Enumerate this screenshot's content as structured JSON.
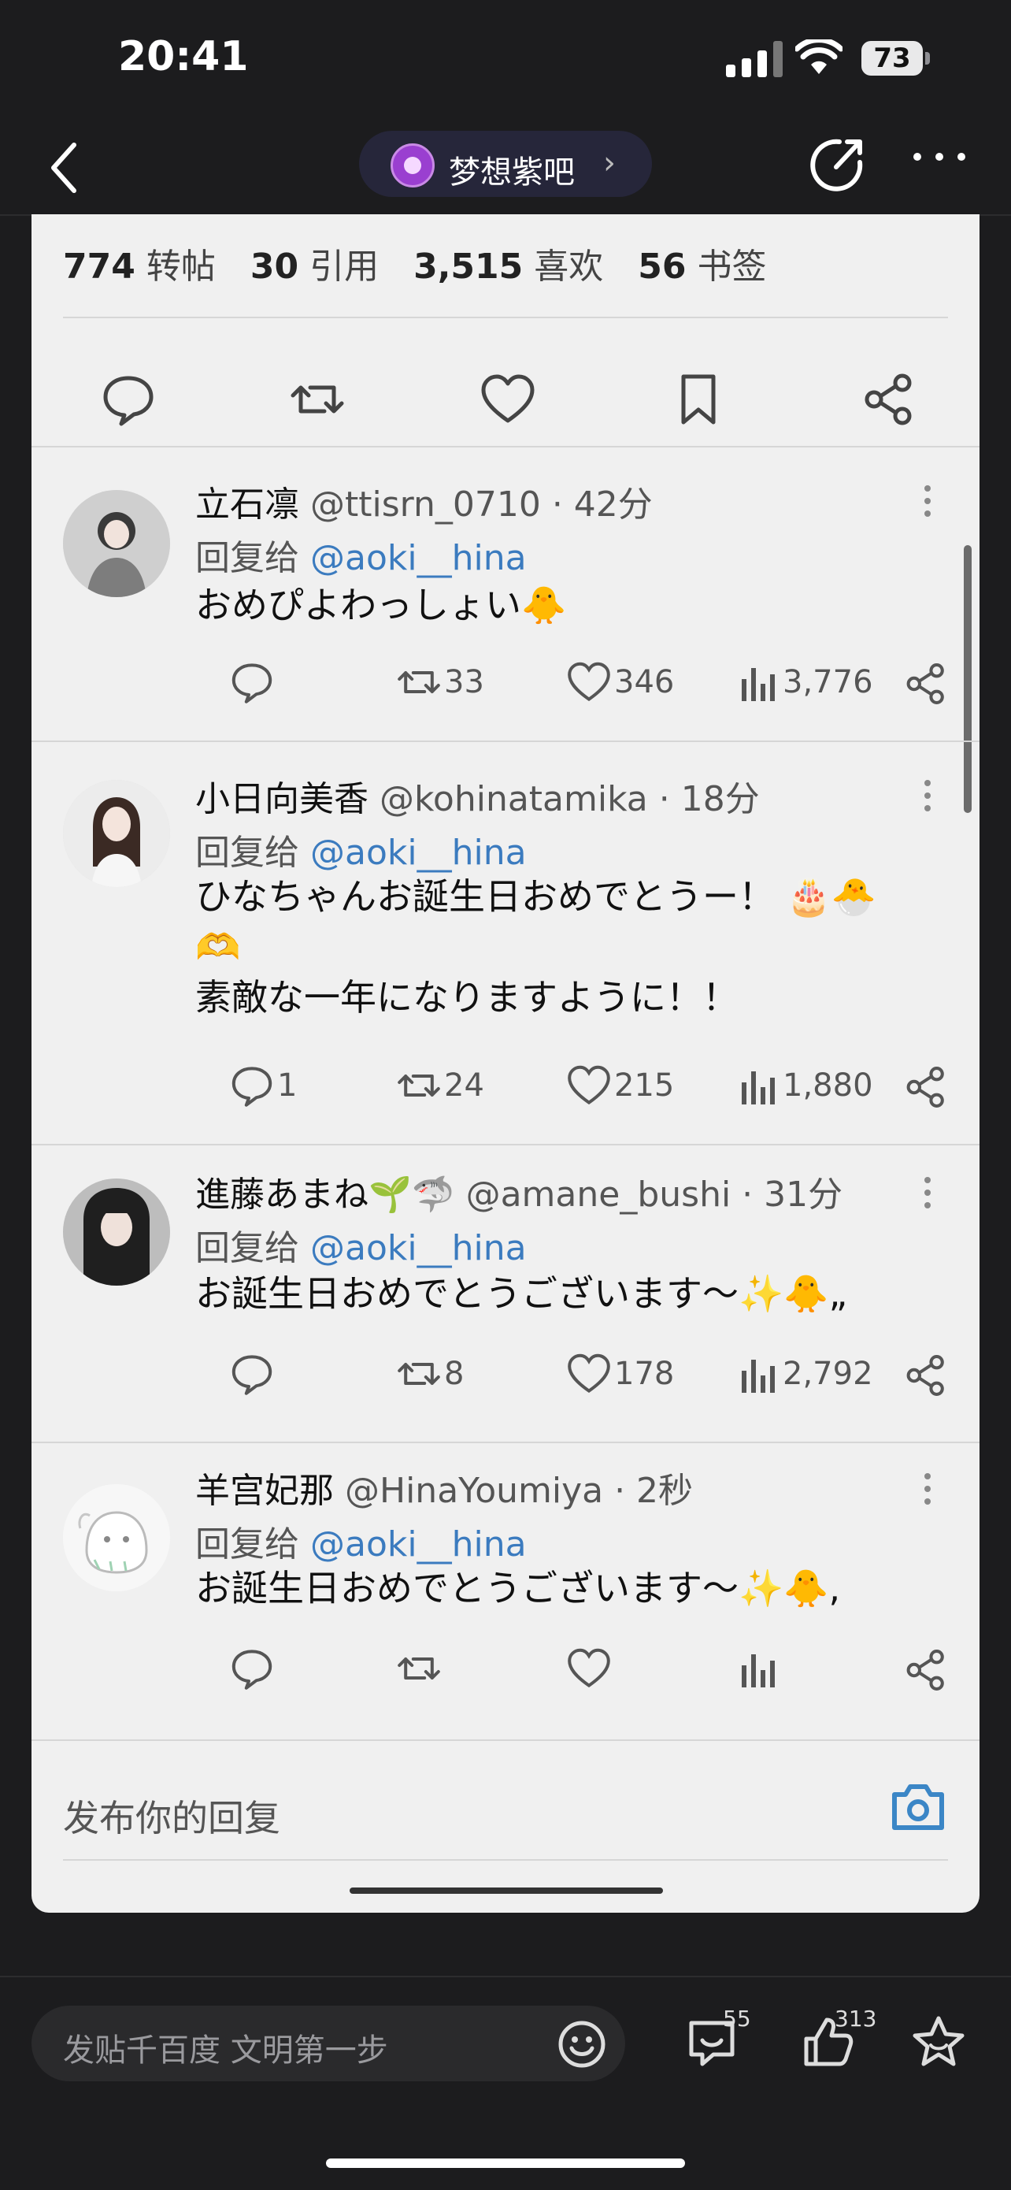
{
  "status": {
    "time": "20:41",
    "battery": "73"
  },
  "nav": {
    "forum_name": "梦想紫吧",
    "forum_chevron": "›"
  },
  "tweet_stats": {
    "retweets_num": "774",
    "retweets_label": "转帖",
    "quotes_num": "30",
    "quotes_label": "引用",
    "likes_num": "3,515",
    "likes_label": "喜欢",
    "bookmarks_num": "56",
    "bookmarks_label": "书签"
  },
  "replies": [
    {
      "name": "立石凛",
      "handle": "@ttisrn_0710 · 42分",
      "reply_to_prefix": "回复给",
      "reply_to": "@aoki__hina",
      "body": "おめぴよわっしょい🐥",
      "comments": "",
      "retweets": "33",
      "likes": "346",
      "views": "3,776"
    },
    {
      "name": "小日向美香",
      "handle": "@kohinatamika · 18分",
      "reply_to_prefix": "回复给",
      "reply_to": "@aoki__hina",
      "body_line1": "ひなちゃんお誕生日おめでとうー！ 🎂🐣",
      "body_line2": "🫶",
      "body_line3": "素敵な一年になりますように！！",
      "comments": "1",
      "retweets": "24",
      "likes": "215",
      "views": "1,880"
    },
    {
      "name": "進藤あまね🌱🦈",
      "handle": "@amane_bushi · 31分",
      "reply_to_prefix": "回复给",
      "reply_to": "@aoki__hina",
      "body": "お誕生日おめでとうございます〜✨🐥„",
      "comments": "",
      "retweets": "8",
      "likes": "178",
      "views": "2,792"
    },
    {
      "name": "羊宫妃那",
      "handle": "@HinaYoumiya · 2秒",
      "reply_to_prefix": "回复给",
      "reply_to": "@aoki__hina",
      "body": "お誕生日おめでとうございます〜✨🐥,",
      "comments": "",
      "retweets": "",
      "likes": "",
      "views": ""
    }
  ],
  "reply_input_placeholder": "发布你的回复",
  "bottom": {
    "compose_placeholder": "发贴千百度 文明第一步",
    "comment_count": "55",
    "like_count": "313"
  },
  "colors": {
    "mention": "#3b7bbf",
    "card_bg": "#f0f0f0",
    "app_bg": "#1c1c1e"
  }
}
